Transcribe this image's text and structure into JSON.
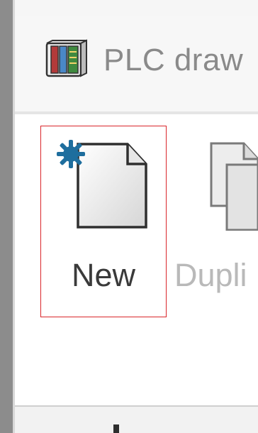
{
  "window": {
    "title": "PLC draw"
  },
  "app_icon": {
    "name": "plc-module-icon"
  },
  "ribbon": {
    "buttons": [
      {
        "label": "New",
        "icon": "new-document-icon",
        "selected": true
      },
      {
        "label": "Dupli",
        "icon": "duplicate-document-icon",
        "selected": false
      }
    ]
  },
  "colors": {
    "selection_border": "#d9262b",
    "new_badge": "#1e6e9e",
    "title_text": "#8a8a8a"
  }
}
